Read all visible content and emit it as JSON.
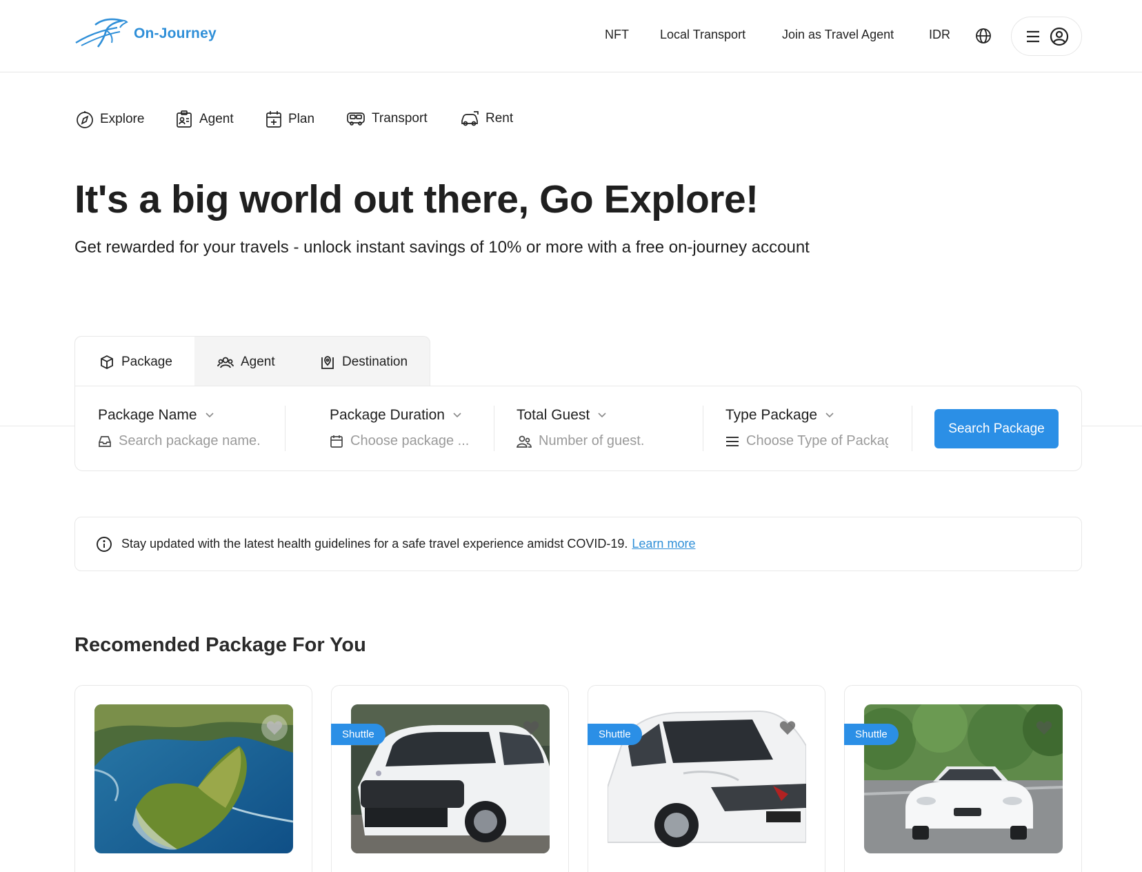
{
  "header": {
    "brand": "On-Journey",
    "nav": [
      "NFT",
      "Local Transport",
      "Join as Travel Agent",
      "IDR"
    ],
    "icons": [
      "globe-icon",
      "menu-icon",
      "user-circle-icon"
    ]
  },
  "categories": [
    {
      "label": "Explore",
      "icon": "compass-icon"
    },
    {
      "label": "Agent",
      "icon": "agent-icon"
    },
    {
      "label": "Plan",
      "icon": "calendar-plan-icon"
    },
    {
      "label": "Transport",
      "icon": "bus-icon"
    },
    {
      "label": "Rent",
      "icon": "car-rent-icon"
    }
  ],
  "hero": {
    "title": "It's a big world out there, Go Explore!",
    "subtitle": "Get rewarded for your travels - unlock instant savings of 10% or more with a free on-journey account"
  },
  "search": {
    "tabs": [
      {
        "label": "Package",
        "icon": "cube-icon",
        "active": true
      },
      {
        "label": "Agent",
        "icon": "users-icon",
        "active": false
      },
      {
        "label": "Destination",
        "icon": "map-pin-icon",
        "active": false
      }
    ],
    "fields": [
      {
        "label": "Package Name",
        "placeholder": "Search package name."
      },
      {
        "label": "Package Duration",
        "placeholder": "Choose package ..."
      },
      {
        "label": "Total Guest",
        "placeholder": "Number of guest."
      },
      {
        "label": "Type Package",
        "placeholder": "Choose Type of Packag"
      }
    ],
    "button": "Search Package"
  },
  "notice": {
    "text": "Stay updated with the latest health guidelines for a safe travel experience amidst COVID-19.",
    "link": "Learn more"
  },
  "recommended": {
    "title": "Recomended Package For You",
    "cards": [
      {
        "badge": "",
        "image": "coastal-cliff-island-photo"
      },
      {
        "badge": "Shuttle",
        "image": "white-compact-suv-photo"
      },
      {
        "badge": "Shuttle",
        "image": "white-suv-photo"
      },
      {
        "badge": "Shuttle",
        "image": "white-sedan-photo"
      }
    ]
  },
  "colors": {
    "accent": "#2b8fe6",
    "brand": "#2f8fd8",
    "text": "#1f1f1f",
    "border": "#e8e8e8"
  }
}
